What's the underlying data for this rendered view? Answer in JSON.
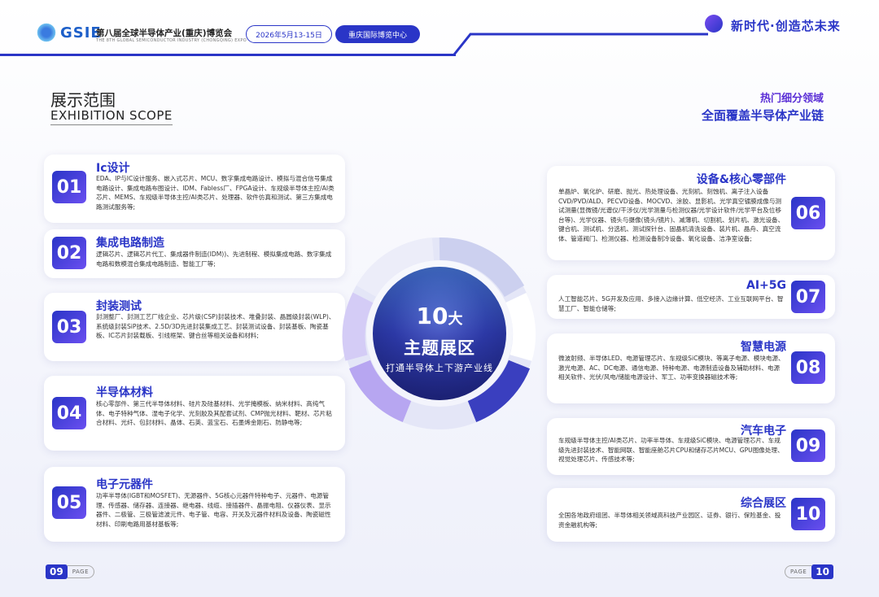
{
  "header": {
    "logo_text": "GSIE",
    "expo_title": "第八届全球半导体产业(重庆)博览会",
    "expo_subtitle": "THE 8TH GLOBAL SEMICONDUCTOR INDUSTRY (CHONGQING) EXPO",
    "date": "2026年5月13-15日",
    "venue": "重庆国际博览中心",
    "slogan": "新时代·创造芯未来"
  },
  "section": {
    "title_cn": "展示范围",
    "title_en": "EXHIBITION SCOPE",
    "tag_hot": "热门细分领域",
    "tag_full": "全面覆盖半导体产业链"
  },
  "center": {
    "number": "10",
    "number_unit": "大",
    "main": "主题展区",
    "sub": "打通半导体上下游产业线"
  },
  "left_cards": [
    {
      "num": "01",
      "title": "Ic设计",
      "body": "EDA、IP与IC设计服务、嵌入式芯片、MCU、数字集成电路设计、模拟与混合信号集成电路设计、集成电路布图设计、IDM、Fabless厂、FPGA设计、车规级半导体主控/AI类芯片、MEMS、车规级半导体主控/AI类芯片、处理器、软件仿真和测试、第三方集成电路测试服务等;"
    },
    {
      "num": "02",
      "title": "集成电路制造",
      "body": "逻辑芯片、逻辑芯片代工、集成器件制造(IDM))、先进制程、模拟集成电路、数字集成电路和数模混合集成电路制造、智能工厂等;"
    },
    {
      "num": "03",
      "title": "封装测试",
      "body": "封测整厂、封测工艺厂线企业、芯片级(CSP)封装技术、堆叠封装、晶圆级封装(WLP)、系统级封装SiP技术、2.5D/3D先进封装集成工艺、封装测试设备、封装基板、陶瓷基板、IC芯片封装载板、引线框架、键合丝等相关设备和材料;"
    },
    {
      "num": "04",
      "title": "半导体材料",
      "body": "核心零部件、第三代半导体材料、硅片及硅基材料、光学掩模板、纳米材料、高纯气体、电子特种气体、湿电子化学、光刻胶及其配套试剂、CMP抛光材料、靶材、芯片粘合材料、光纤、包封材料、晶体、石英、蓝宝石、石墨烯金刚石、防静电等;"
    },
    {
      "num": "05",
      "title": "电子元器件",
      "body": "功率半导体(IGBT和MOSFET)、无源器件、5G核心元器件特种电子、元器件、电源管理、传感器、储存器、连接器、继电器、线缆、接插器件、晶振电阻、仪器仪表、显示器件、二极管、三极管滤波元件、电子管、电容、开关及元器件材料及设备、陶瓷磁性材料、印刷电路用基材基板等;"
    }
  ],
  "right_cards": [
    {
      "num": "06",
      "title": "设备&核心零部件",
      "body": "单晶炉、氧化炉、研磨、抛光、热处理设备、光刻机、刻蚀机、离子注入设备CVD/PVD/ALD、PECVD设备、MOCVD、涂胶、显影机、光学真空镀膜成像与测试测量(显微镜/光谱仪/干涉仪/光学测量与检测仪器/光学设计软件/光学平台及位移台等)、光学仪器、镜头与摄像(镜头/镜片)、减薄机、切割机、划片机、激光设备、键合机、测试机、分选机、测试探针台、固晶机清洗设备、装片机、晶舟、真空流体、管道阀门、检测仪器、检测设备制冷设备、氧化设备、洁净室设备;"
    },
    {
      "num": "07",
      "title": "AI+5G",
      "body": "人工智能芯片、5G开发及应用、多接入边缘计算、低空经济、工业互联网平台、智慧工厂、智能仓储等;"
    },
    {
      "num": "08",
      "title": "智慧电源",
      "body": "微波射频、半导体LED、电源管理芯片、车规级SiC模块、等离子电源、模块电源、激光电源、AC、DC电源、通信电源、特种电源、电源制造设备及辅助材料、电源相关软件、光伏/风电/储能电源设计、军工、功率变换器磁技术等;"
    },
    {
      "num": "09",
      "title": "汽车电子",
      "body": "车规级半导体主控/AI类芯片、功率半导体、车规级SiC模块、电源管理芯片、车规级先进封装技术、智能网联、智能座舱芯片CPU和储存芯片MCU、GPU图像处理、视觉处理芯片、传感技术等;"
    },
    {
      "num": "10",
      "title": "综合展区",
      "body": "全国各地政府组团、半导体相关领域高科技产业园区、证券、银行、保险基金、投资金融机构等;"
    }
  ],
  "pages": {
    "left_num": "09",
    "left_label": "PAGE",
    "right_num": "10",
    "right_label": "PAGE"
  },
  "colors": {
    "primary": "#2a35c7",
    "accent": "#6a4ff0",
    "hot": "#5b2fd6"
  }
}
